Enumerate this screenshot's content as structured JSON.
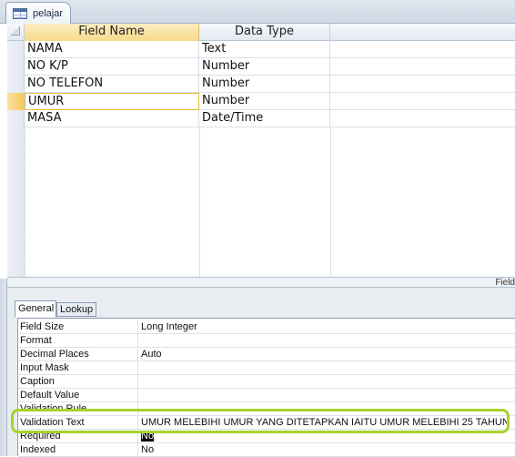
{
  "document_tab": {
    "label": "pelajar",
    "icon": "table-icon"
  },
  "grid": {
    "headers": {
      "field_name": "Field Name",
      "data_type": "Data Type",
      "description": ""
    },
    "rows": [
      {
        "field_name": "NAMA",
        "data_type": "Text"
      },
      {
        "field_name": "NO K/P",
        "data_type": "Number"
      },
      {
        "field_name": "NO TELEFON",
        "data_type": "Number"
      },
      {
        "field_name": "UMUR",
        "data_type": "Number"
      },
      {
        "field_name": "MASA",
        "data_type": "Date/Time"
      }
    ],
    "current_row_index": 3
  },
  "field_properties_label": "Field",
  "properties": {
    "tabs": {
      "general": "General",
      "lookup": "Lookup"
    },
    "active_tab": "General",
    "rows": [
      {
        "label": "Field Size",
        "value": "Long Integer"
      },
      {
        "label": "Format",
        "value": ""
      },
      {
        "label": "Decimal Places",
        "value": "Auto"
      },
      {
        "label": "Input Mask",
        "value": ""
      },
      {
        "label": "Caption",
        "value": ""
      },
      {
        "label": "Default Value",
        "value": ""
      },
      {
        "label": "Validation Rule",
        "value": ""
      },
      {
        "label": "Validation Text",
        "value": "UMUR MELEBIHI UMUR YANG DITETAPKAN IAITU UMUR MELEBIHI 25 TAHUN"
      },
      {
        "label": "Required",
        "value": "No"
      },
      {
        "label": "Indexed",
        "value": "No"
      }
    ]
  },
  "colors": {
    "highlight_outline": "#a7d22b",
    "current_row_selector": "#f5c85d",
    "field_name_header": "#f7d98a"
  }
}
